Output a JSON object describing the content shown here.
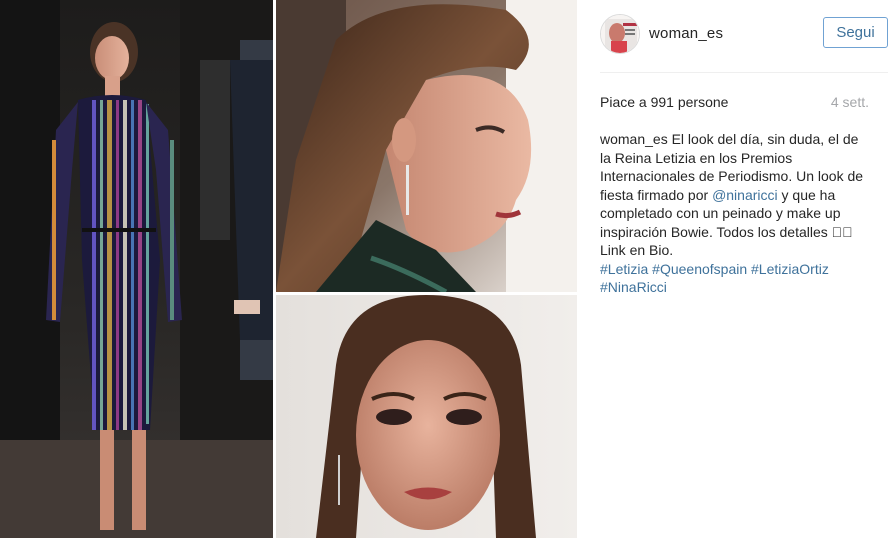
{
  "post": {
    "username": "woman_es",
    "follow_label": "Segui",
    "likes": "Piace a 991 persone",
    "age": "4 sett.",
    "caption": {
      "user": "woman_es",
      "text_part1": " El look del día, sin duda, el de la Reina Letizia en los Premios Internacionales de Periodismo. Un look de fiesta firmado por ",
      "mention": "@ninaricci",
      "text_part2": " y que ha completado con un peinado y make up inspiración Bowie. Todos los detalles ",
      "emoji": "\u0000\u0000",
      "text_part3": " Link en Bio.",
      "hashtags": [
        "#Letizia",
        "#Queenofspain",
        "#LetiziaOrtiz",
        "#NinaRicci"
      ]
    }
  },
  "colors": {
    "link": "#3f729b",
    "text": "#262626",
    "muted": "#a5a7aa",
    "button_border": "#70a2d3"
  }
}
